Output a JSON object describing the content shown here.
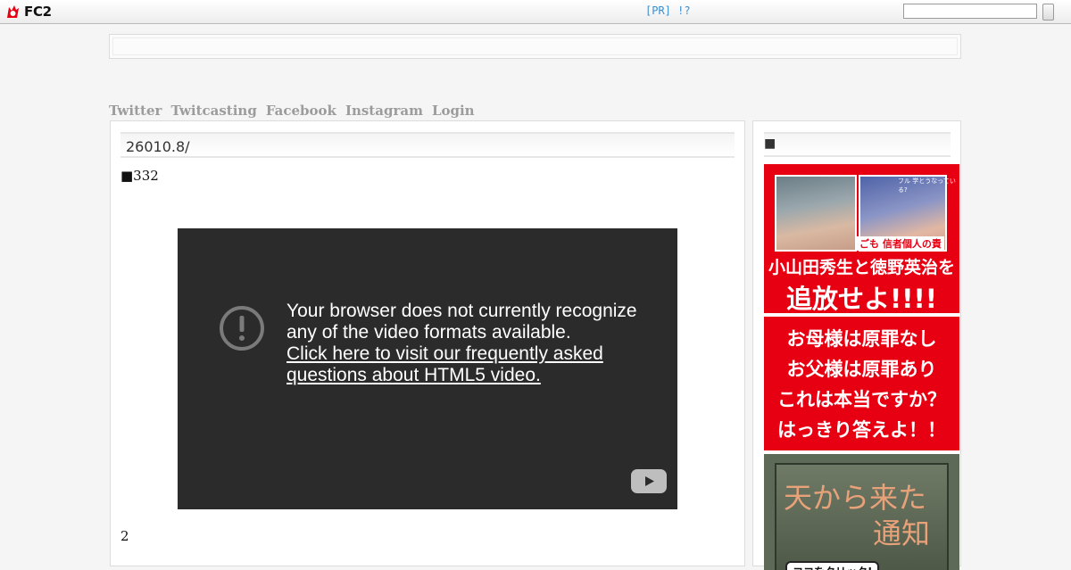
{
  "topbar": {
    "logo_text": "FC2",
    "pr_link": "[PR] !?",
    "search": {
      "value": "",
      "placeholder": ""
    }
  },
  "nav": {
    "items": [
      "Twitter",
      "Twitcasting",
      "Facebook",
      "Instagram",
      "Login"
    ]
  },
  "entry": {
    "title": "26010.8/",
    "subtitle": "■332",
    "footer": "2"
  },
  "video": {
    "message": "Your browser does not currently recognize any of the video formats available.",
    "link": "Click here to visit our frequently asked questions about HTML5 video."
  },
  "sidebar": {
    "title": "■",
    "ad1": {
      "tag": "フル 学とうなっている?",
      "label": "ごも 信者個人の責",
      "line1": "小山田秀生と徳野英治を",
      "line2": "追放せよ!!!!"
    },
    "ad2": {
      "lines": [
        "お母様は原罪なし",
        "お父様は原罪あり",
        "これは本当ですか？",
        "はっきり答えよ！！"
      ]
    },
    "ad3": {
      "title1": "天から来た",
      "title2": "通知",
      "button": "ココをクリック!"
    }
  },
  "colors": {
    "accent": "#3a8fd0",
    "ad_red": "#e60012",
    "video_bg": "#2b2b2b"
  }
}
